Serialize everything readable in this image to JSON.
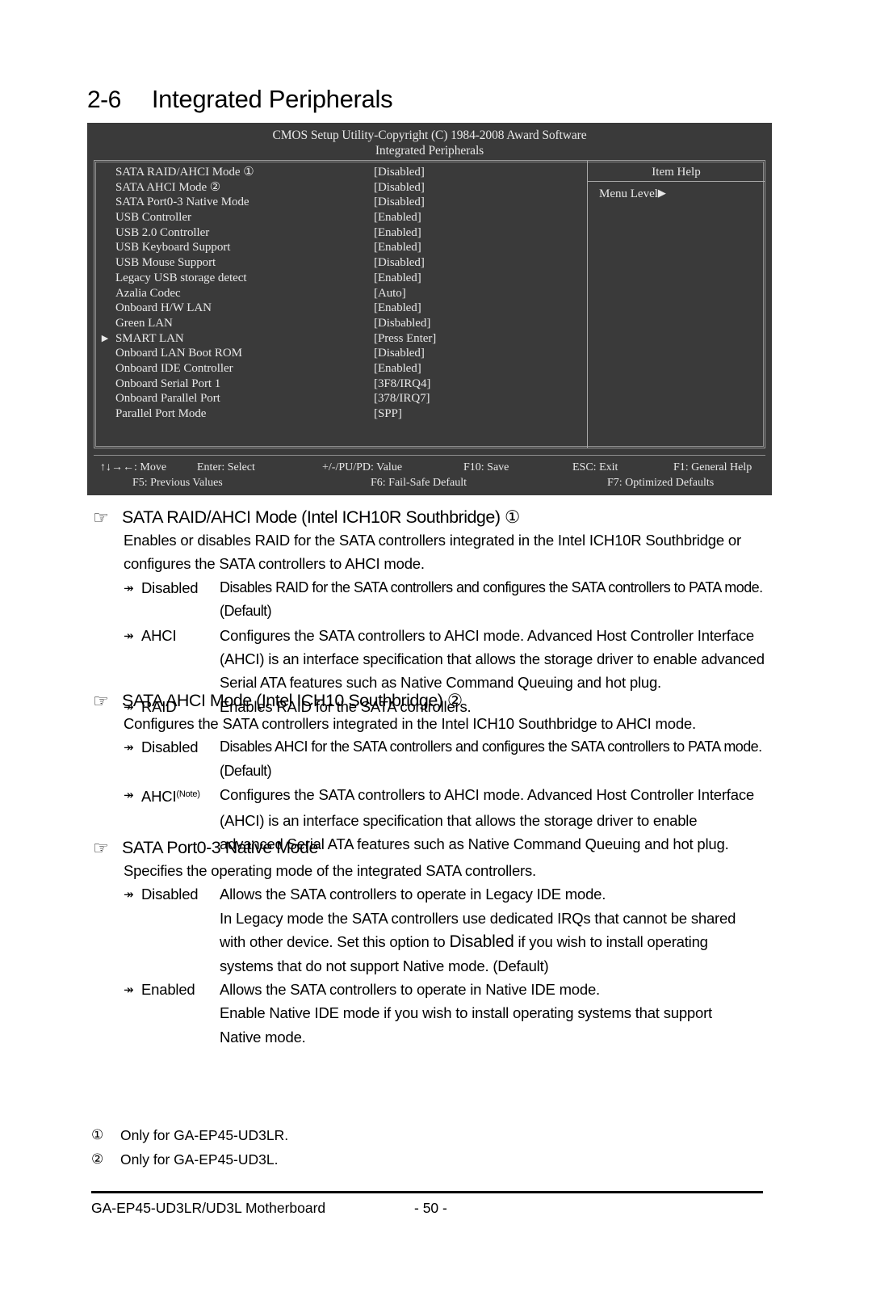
{
  "page": {
    "section_number": "2-6",
    "section_title": "Integrated Peripherals",
    "footer_board": "GA-EP45-UD3LR/UD3L Motherboard",
    "footer_page": "- 50 -"
  },
  "bios": {
    "title": "CMOS Setup Utility-Copyright (C) 1984-2008 Award Software",
    "subtitle": "Integrated Peripherals",
    "item_help_title": "Item Help",
    "menu_level": "Menu Level",
    "menu_level_arrow": "▶",
    "submenu_marker": "▶",
    "settings": [
      {
        "marker": "",
        "label": "SATA RAID/AHCI Mode ①",
        "value": "[Disabled]"
      },
      {
        "marker": "",
        "label": "SATA AHCI Mode ②",
        "value": "[Disabled]"
      },
      {
        "marker": "",
        "label": "SATA Port0-3 Native Mode",
        "value": "[Disabled]"
      },
      {
        "marker": "",
        "label": "USB Controller",
        "value": "[Enabled]"
      },
      {
        "marker": "",
        "label": "USB 2.0 Controller",
        "value": "[Enabled]"
      },
      {
        "marker": "",
        "label": "USB Keyboard Support",
        "value": "[Enabled]"
      },
      {
        "marker": "",
        "label": "USB Mouse Support",
        "value": "[Disabled]"
      },
      {
        "marker": "",
        "label": "Legacy USB storage detect",
        "value": "[Enabled]"
      },
      {
        "marker": "",
        "label": "Azalia Codec",
        "value": "[Auto]"
      },
      {
        "marker": "",
        "label": "Onboard H/W LAN",
        "value": "[Enabled]"
      },
      {
        "marker": "",
        "label": "Green LAN",
        "value": "[Disbabled]"
      },
      {
        "marker": "▶",
        "label": "SMART LAN",
        "value": "[Press Enter]"
      },
      {
        "marker": "",
        "label": "Onboard LAN Boot ROM",
        "value": "[Disabled]"
      },
      {
        "marker": "",
        "label": "Onboard IDE Controller",
        "value": "[Enabled]"
      },
      {
        "marker": "",
        "label": "Onboard Serial Port 1",
        "value": "[3F8/IRQ4]"
      },
      {
        "marker": "",
        "label": "Onboard Parallel Port",
        "value": "[378/IRQ7]"
      },
      {
        "marker": "",
        "label": "Parallel Port Mode",
        "value": "[SPP]"
      }
    ],
    "keys_row1": [
      "↑↓→←: Move",
      "Enter: Select",
      "+/-/PU/PD: Value",
      "F10: Save",
      "ESC: Exit",
      "F1: General Help"
    ],
    "keys_row2": [
      "F5: Previous Values",
      "F6: Fail-Safe Default",
      "F7: Optimized Defaults"
    ]
  },
  "sections": [
    {
      "heading": "SATA RAID/AHCI Mode (Intel ICH10R Southbridge) ①",
      "intro": "Enables or disables RAID for the SATA controllers integrated in the Intel ICH10R Southbridge or configures the SATA controllers to AHCI mode.",
      "options": [
        {
          "bullet": "↠",
          "name": "Disabled",
          "narrow": true,
          "desc": "Disables RAID for the SATA controllers and configures the SATA controllers to PATA mode. (Default)",
          "cont": []
        },
        {
          "bullet": "↠",
          "name": "AHCI",
          "narrow": false,
          "desc": "Configures the SATA controllers to AHCI mode. Advanced Host Controller Interface",
          "cont": [
            "(AHCI) is an interface specification that allows the storage driver to enable advanced",
            "Serial ATA features such as Native Command Queuing and hot plug."
          ]
        },
        {
          "bullet": "↠",
          "name": "RAID",
          "narrow": false,
          "desc": "Enables RAID for the SATA controllers.",
          "cont": []
        }
      ]
    },
    {
      "heading": "SATA AHCI Mode (Intel ICH10 Southbridge) ②",
      "intro": "Configures the SATA controllers integrated in the Intel ICH10 Southbridge to AHCI mode.",
      "options": [
        {
          "bullet": "↠",
          "name": "Disabled",
          "narrow": true,
          "desc": "Disables AHCI for the SATA controllers and configures the SATA controllers to PATA mode. (Default)",
          "cont": []
        },
        {
          "bullet": "↠",
          "name": "AHCI",
          "name_sup": "(Note)",
          "narrow": false,
          "desc": "Configures the SATA controllers to AHCI mode. Advanced Host Controller Interface",
          "cont": [
            "(AHCI) is an interface specification that allows the storage driver to enable",
            "advanced Serial ATA features such as Native Command Queuing and hot plug."
          ]
        }
      ]
    },
    {
      "heading": "SATA Port0-3 Native Mode",
      "intro": "Specifies the operating mode of the integrated SATA controllers.",
      "options": [
        {
          "bullet": "↠",
          "name": "Disabled",
          "narrow": false,
          "desc": "Allows the SATA controllers to operate in Legacy IDE mode.",
          "cont": [
            "In Legacy mode the SATA controllers use dedicated IRQs that cannot be shared",
            "with other device. Set this option to Disabled if you wish to install operating",
            "systems that do not support Native mode. (Default)"
          ]
        },
        {
          "bullet": "↠",
          "name": "Enabled",
          "narrow": false,
          "desc": "Allows the SATA controllers to operate in Native IDE mode.",
          "cont": [
            "Enable Native IDE mode if you wish to install operating systems that support",
            "Native mode."
          ]
        }
      ]
    }
  ],
  "footnotes": [
    {
      "num": "①",
      "text": "Only for GA-EP45-UD3LR."
    },
    {
      "num": "②",
      "text": "Only for GA-EP45-UD3L."
    }
  ]
}
